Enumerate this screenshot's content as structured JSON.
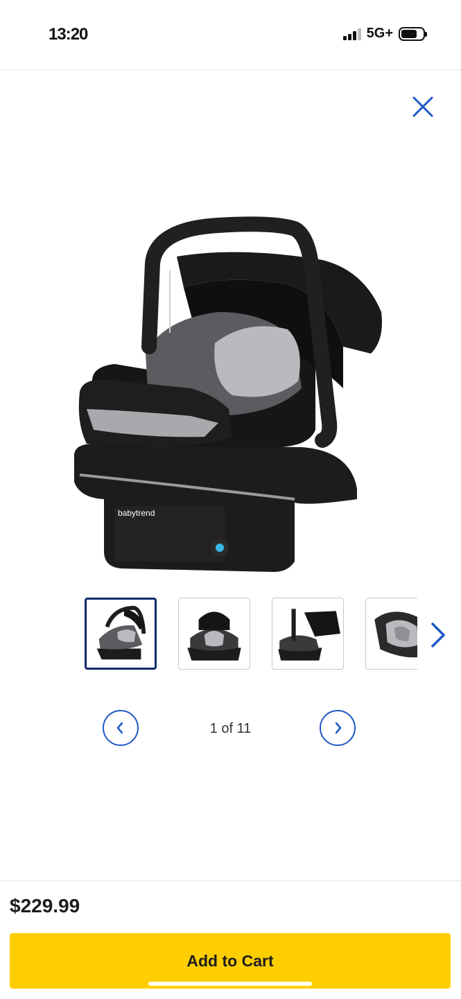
{
  "status_bar": {
    "time": "13:20",
    "network": "5G+",
    "icons": [
      "signal-icon",
      "battery-icon"
    ]
  },
  "close": {
    "icon": "close-icon",
    "color": "#1d57c4"
  },
  "product_image": {
    "brand_text": "babytrend"
  },
  "gallery": {
    "thumbnails": [
      {
        "name": "thumb-1",
        "selected": true
      },
      {
        "name": "thumb-2",
        "selected": false
      },
      {
        "name": "thumb-3",
        "selected": false
      },
      {
        "name": "thumb-4",
        "selected": false
      }
    ],
    "next_icon": "chevron-right-icon",
    "counter": "1 of 11",
    "prev_icon": "chevron-left-icon"
  },
  "purchase": {
    "price": "$229.99",
    "add_to_cart": "Add to Cart",
    "button_color": "#ffce00"
  }
}
